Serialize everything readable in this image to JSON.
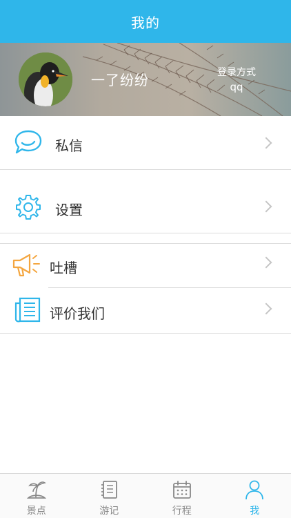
{
  "header": {
    "title": "我的"
  },
  "profile": {
    "username": "一了纷纷",
    "login_label": "登录方式",
    "login_value": "qq"
  },
  "menu": {
    "messages": {
      "label": "私信",
      "icon": "chat-bubble-icon"
    },
    "settings": {
      "label": "设置",
      "icon": "gear-icon"
    },
    "feedback": {
      "label": "吐槽",
      "icon": "megaphone-icon"
    },
    "rate": {
      "label": "评价我们",
      "icon": "notebook-icon"
    }
  },
  "tabs": [
    {
      "label": "景点",
      "icon": "island-icon",
      "active": false
    },
    {
      "label": "游记",
      "icon": "journal-icon",
      "active": false
    },
    {
      "label": "行程",
      "icon": "calendar-icon",
      "active": false
    },
    {
      "label": "我",
      "icon": "person-icon",
      "active": true
    }
  ],
  "colors": {
    "accent": "#2fb6ea",
    "feedback_icon": "#f4a640",
    "divider": "#dcdcdc",
    "tab_inactive": "#888888"
  }
}
